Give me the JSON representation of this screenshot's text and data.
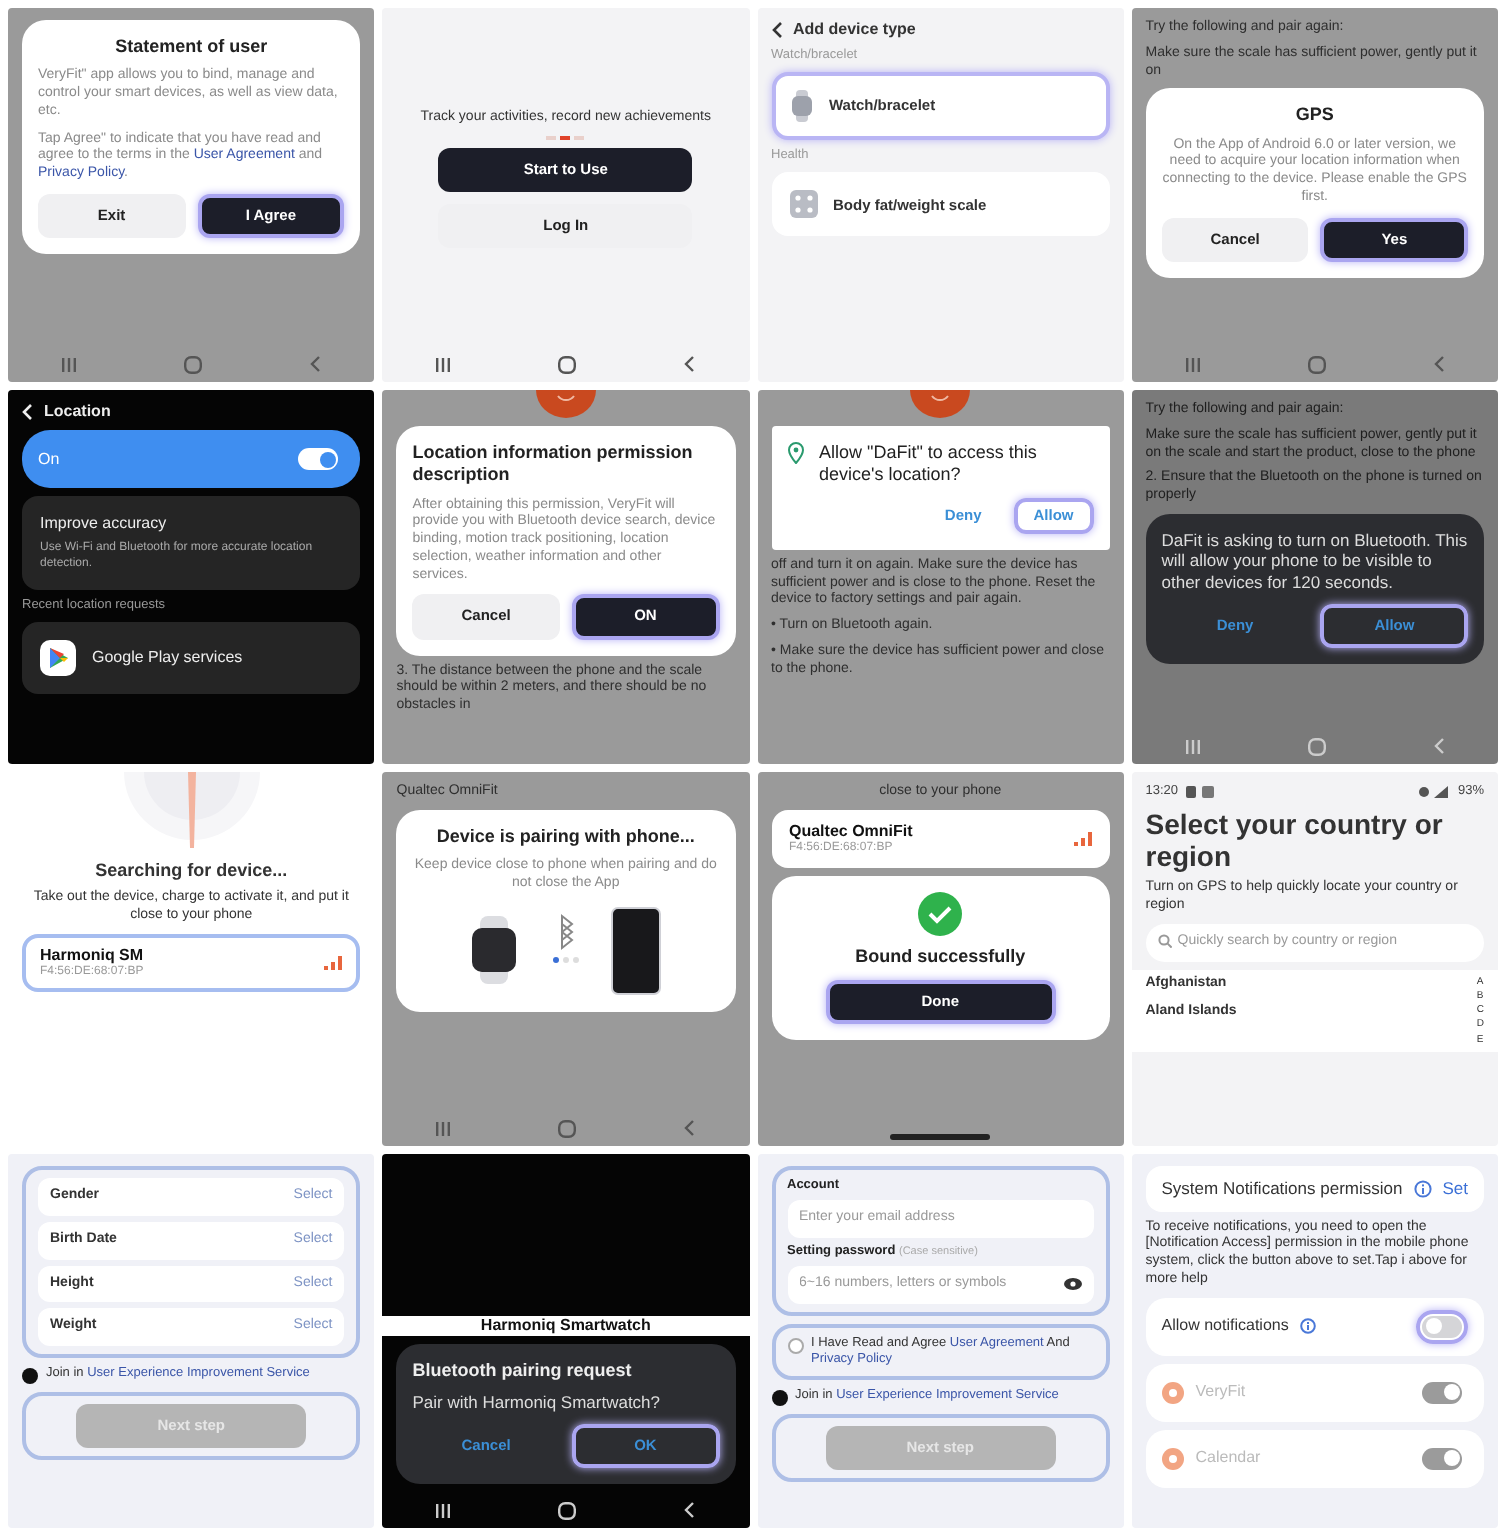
{
  "panels": [
    {
      "blocks": [
        {
          "kind": "card",
          "blocks": [
            {
              "kind": "title",
              "text": "Statement of user"
            },
            {
              "kind": "para",
              "text": "VeryFit\" app allows you to bind, manage and control your smart devices, as well as view data, etc."
            },
            {
              "kind": "para",
              "segments": [
                {
                  "text": "Tap Agree\" to indicate that you have read and agree to the terms in the ",
                  "link": false
                },
                {
                  "text": "User Agreement",
                  "link": true
                },
                {
                  "text": " and ",
                  "link": false
                },
                {
                  "text": "Privacy Policy",
                  "link": true
                },
                {
                  "text": ".",
                  "link": false
                }
              ]
            },
            {
              "kind": "button-row",
              "items": [
                {
                  "kind": "secondary",
                  "label": "Exit",
                  "highlighted": false
                },
                {
                  "kind": "primary",
                  "label": "I Agree",
                  "highlighted": true
                }
              ]
            }
          ]
        }
      ]
    },
    {
      "blocks": [
        {
          "kind": "centered",
          "text": "Track your activities, record new achievements"
        },
        {
          "kind": "dots",
          "items": [
            {
              "selected": false
            },
            {
              "selected": true
            },
            {
              "selected": false
            }
          ]
        },
        {
          "kind": "button-stack",
          "items": [
            {
              "kind": "primary",
              "label": "Start to Use",
              "highlighted": false
            },
            {
              "kind": "secondary",
              "label": "Log In",
              "highlighted": false
            }
          ]
        }
      ]
    },
    {
      "blocks": [
        {
          "kind": "header",
          "text": "Add device type"
        },
        {
          "kind": "label",
          "text": "Watch/bracelet"
        },
        {
          "kind": "watch-option",
          "text": "Watch/bracelet",
          "highlighted": true
        },
        {
          "kind": "label",
          "text": "Health"
        },
        {
          "kind": "scale-option",
          "text": "Body fat/weight scale",
          "highlighted": false
        }
      ]
    },
    {
      "blocks": [
        {
          "kind": "para",
          "text": "Try the following and pair again:"
        },
        {
          "kind": "para",
          "text": "Make sure the scale has sufficient power, gently put it on"
        },
        {
          "kind": "card",
          "blocks": [
            {
              "kind": "title",
              "text": "GPS"
            },
            {
              "kind": "centered",
              "text": "On the App of Android 6.0 or later version, we need to acquire your location information when connecting to the device. Please enable the GPS first."
            },
            {
              "kind": "button-row",
              "items": [
                {
                  "kind": "secondary",
                  "label": "Cancel",
                  "highlighted": false
                },
                {
                  "kind": "primary",
                  "label": "Yes",
                  "highlighted": true
                }
              ]
            }
          ]
        }
      ]
    },
    {
      "blocks": [
        {
          "kind": "header",
          "text": "Location"
        },
        {
          "kind": "main-toggle",
          "text": "On",
          "on": true
        },
        {
          "kind": "detail-option",
          "text": "Improve accuracy",
          "sub": "Use Wi-Fi and Bluetooth for more accurate location detection."
        },
        {
          "kind": "label",
          "text": "Recent location requests"
        },
        {
          "kind": "app-option",
          "text": "Google Play services"
        }
      ]
    },
    {
      "blocks": [
        {
          "kind": "circle-top"
        },
        {
          "kind": "card",
          "blocks": [
            {
              "kind": "heading",
              "text": "Location information permission description"
            },
            {
              "kind": "para",
              "text": "After obtaining this permission, VeryFit will provide you with Bluetooth device search, device binding, motion track positioning, location selection, weather information and other services."
            },
            {
              "kind": "button-row",
              "items": [
                {
                  "kind": "secondary",
                  "label": "Cancel",
                  "highlighted": false
                },
                {
                  "kind": "primary",
                  "label": "ON",
                  "highlighted": true
                }
              ]
            }
          ]
        },
        {
          "kind": "para",
          "text": "3. The distance between the phone and the scale should be within 2 meters, and there should be no obstacles in"
        }
      ]
    },
    {
      "blocks": [
        {
          "kind": "circle-top"
        },
        {
          "kind": "square-card",
          "blocks": [
            {
              "kind": "pin-title",
              "text": "Allow \"DaFit\" to access this device's location?"
            },
            {
              "kind": "button-end",
              "items": [
                {
                  "kind": "text",
                  "label": "Deny",
                  "highlighted": false
                },
                {
                  "kind": "text",
                  "label": "Allow",
                  "highlighted": true
                }
              ]
            }
          ]
        },
        {
          "kind": "para",
          "text": "off and turn it on again. Make sure the device has sufficient power and is close to the phone. Reset the device to factory settings and pair again."
        },
        {
          "kind": "para",
          "text": "• Turn on Bluetooth again."
        },
        {
          "kind": "para",
          "text": "• Make sure the device has sufficient power and close to the phone."
        }
      ]
    },
    {
      "blocks": [
        {
          "kind": "para",
          "text": "Try the following and pair again:"
        },
        {
          "kind": "para",
          "text": "Make sure the scale has sufficient power, gently put it on the scale and start the product, close to the phone"
        },
        {
          "kind": "para",
          "text": "2. Ensure that the Bluetooth on the phone is turned on properly"
        },
        {
          "kind": "dark-card",
          "blocks": [
            {
              "kind": "lead",
              "text": "DaFit is asking to turn on Bluetooth. This will allow your phone to be visible to other devices for 120 seconds."
            },
            {
              "kind": "button-row",
              "items": [
                {
                  "kind": "text",
                  "label": "Deny",
                  "highlighted": false
                },
                {
                  "kind": "text",
                  "label": "Allow",
                  "highlighted": true
                }
              ]
            }
          ]
        }
      ]
    },
    {
      "blocks": [
        {
          "kind": "radar"
        },
        {
          "kind": "title",
          "text": "Searching for device..."
        },
        {
          "kind": "centered",
          "text": "Take out the device, charge to activate it, and put it close to your phone"
        },
        {
          "kind": "device",
          "name": "Harmoniq SM",
          "mac": "F4:56:DE:68:07:BP",
          "highlighted": true
        }
      ]
    },
    {
      "blocks": [
        {
          "kind": "para",
          "text": "Qualtec OmniFit"
        },
        {
          "kind": "card",
          "blocks": [
            {
              "kind": "title",
              "text": "Device is pairing with phone..."
            },
            {
              "kind": "centered",
              "text": "Keep device close to phone when pairing and do not close the App"
            },
            {
              "kind": "pairing"
            }
          ]
        }
      ]
    },
    {
      "blocks": [
        {
          "kind": "centered",
          "text": "close to your phone"
        },
        {
          "kind": "device",
          "name": "Qualtec OmniFit",
          "mac": "F4:56:DE:68:07:BP",
          "highlighted": false
        },
        {
          "kind": "card",
          "blocks": [
            {
              "kind": "success"
            },
            {
              "kind": "title",
              "text": "Bound successfully"
            },
            {
              "kind": "button-stack",
              "items": [
                {
                  "kind": "primary",
                  "label": "Done",
                  "highlighted": true
                }
              ]
            }
          ]
        }
      ]
    },
    {
      "blocks": [
        {
          "kind": "status",
          "time": "13:20",
          "battery": "93%"
        },
        {
          "kind": "big-title",
          "text": "Select your country or region"
        },
        {
          "kind": "para",
          "text": "Turn on GPS to help quickly locate your country or region"
        },
        {
          "kind": "search",
          "placeholder": "Quickly search by country or region"
        },
        {
          "kind": "countries",
          "items": [
            "Afghanistan",
            "Aland Islands"
          ],
          "index": [
            "A",
            "B",
            "C",
            "D",
            "E"
          ]
        }
      ]
    },
    {
      "blocks": [
        {
          "kind": "group",
          "blocks": [
            {
              "kind": "select",
              "text": "Gender",
              "value": "Select"
            },
            {
              "kind": "select",
              "text": "Birth Date",
              "value": "Select"
            },
            {
              "kind": "select",
              "text": "Height",
              "value": "Select"
            },
            {
              "kind": "select",
              "text": "Weight",
              "value": "Select"
            }
          ]
        },
        {
          "kind": "check",
          "checked": true,
          "segments": [
            {
              "text": "Join in ",
              "link": false
            },
            {
              "text": "User Experience Improvement Service",
              "link": true
            }
          ]
        },
        {
          "kind": "group",
          "blocks": [
            {
              "kind": "button-stack",
              "items": [
                {
                  "kind": "disabled",
                  "label": "Next step",
                  "highlighted": false
                }
              ]
            }
          ]
        }
      ]
    },
    {
      "blocks": [
        {
          "kind": "caption",
          "text": "Harmoniq Smartwatch"
        },
        {
          "kind": "dark-card",
          "blocks": [
            {
              "kind": "heading",
              "text": "Bluetooth pairing request"
            },
            {
              "kind": "lead",
              "text": "Pair with Harmoniq Smartwatch?"
            },
            {
              "kind": "button-row",
              "items": [
                {
                  "kind": "text",
                  "label": "Cancel",
                  "highlighted": false
                },
                {
                  "kind": "text",
                  "label": "OK",
                  "highlighted": true
                }
              ]
            }
          ]
        }
      ]
    },
    {
      "blocks": [
        {
          "kind": "group",
          "blocks": [
            {
              "kind": "label",
              "text": "Account"
            },
            {
              "kind": "field",
              "placeholder": "Enter your email address"
            },
            {
              "kind": "label",
              "text": "Setting password",
              "note": "(Case sensitive)"
            },
            {
              "kind": "password-field",
              "placeholder": "6~16 numbers, letters or symbols"
            }
          ]
        },
        {
          "kind": "group",
          "blocks": [
            {
              "kind": "check",
              "checked": false,
              "segments": [
                {
                  "text": "I Have Read and Agree ",
                  "link": false
                },
                {
                  "text": "User Agreement",
                  "link": true
                },
                {
                  "text": " And ",
                  "link": false
                },
                {
                  "text": "Privacy Policy",
                  "link": true
                }
              ]
            }
          ]
        },
        {
          "kind": "check",
          "checked": true,
          "segments": [
            {
              "text": "Join in ",
              "link": false
            },
            {
              "text": "User Experience Improvement Service",
              "link": true
            }
          ]
        },
        {
          "kind": "group",
          "blocks": [
            {
              "kind": "button-stack",
              "items": [
                {
                  "kind": "disabled",
                  "label": "Next step",
                  "highlighted": false
                }
              ]
            }
          ]
        }
      ]
    },
    {
      "blocks": [
        {
          "kind": "setrow",
          "text": "System Notifications permission",
          "action": "Set"
        },
        {
          "kind": "para",
          "text": "To receive notifications, you need to open the [Notification Access] permission in the mobile phone system, click the button above to set.Tap i above for more help"
        },
        {
          "kind": "info-toggle",
          "text": "Allow notifications",
          "on": false,
          "highlighted": true,
          "disabled": false
        },
        {
          "kind": "app-toggle",
          "text": "VeryFit",
          "on": true,
          "highlighted": false,
          "disabled": true
        },
        {
          "kind": "app-toggle",
          "text": "Calendar",
          "on": true,
          "highlighted": false,
          "disabled": true
        }
      ]
    }
  ]
}
